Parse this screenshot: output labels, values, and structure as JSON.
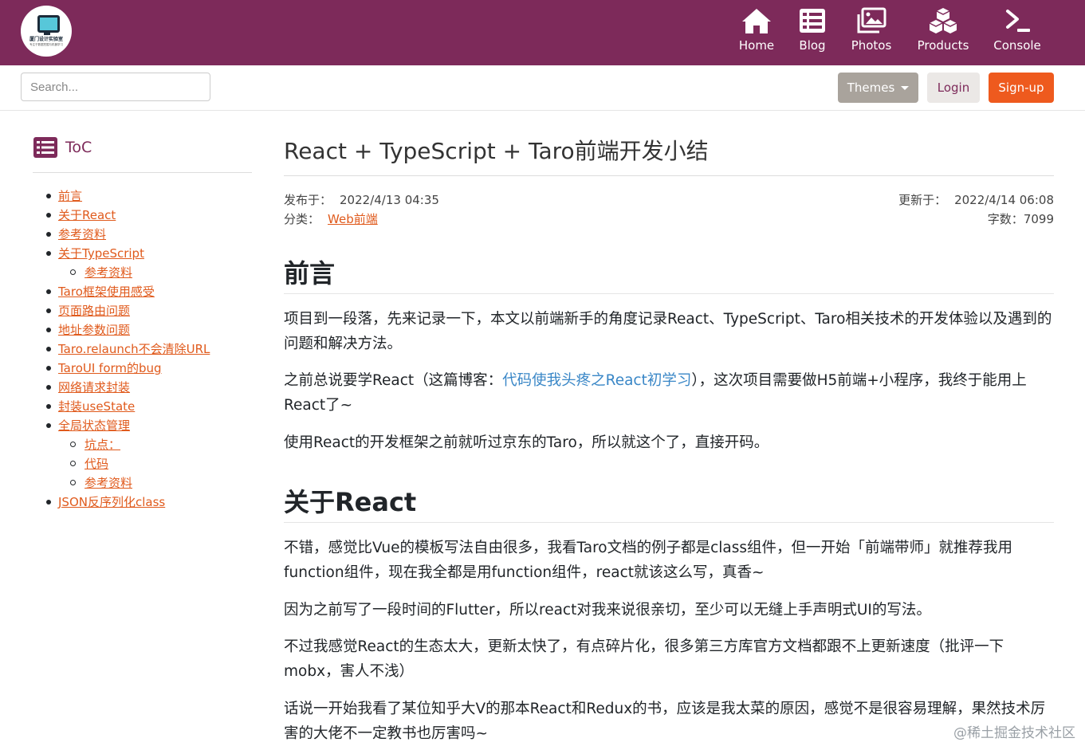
{
  "brand": {
    "logo_text": "厦门设计实验室",
    "logo_subtext": "专注于数据挖掘与机器学习"
  },
  "nav": {
    "items": [
      {
        "label": "Home",
        "icon": "home-icon"
      },
      {
        "label": "Blog",
        "icon": "list-icon"
      },
      {
        "label": "Photos",
        "icon": "photos-icon"
      },
      {
        "label": "Products",
        "icon": "cubes-icon"
      },
      {
        "label": "Console",
        "icon": "terminal-icon"
      }
    ]
  },
  "toolbar": {
    "search_placeholder": "Search...",
    "themes_label": "Themes",
    "login_label": "Login",
    "signup_label": "Sign-up"
  },
  "colors": {
    "brand": "#7d2a5a",
    "accent": "#ee5a1e",
    "link": "#e05a1c"
  },
  "toc": {
    "title": "ToC",
    "items": [
      {
        "label": "前言",
        "level": 1
      },
      {
        "label": "关于React",
        "level": 1
      },
      {
        "label": "参考资料",
        "level": 1
      },
      {
        "label": "关于TypeScript",
        "level": 1
      },
      {
        "label": "参考资料",
        "level": 2
      },
      {
        "label": "Taro框架使用感受",
        "level": 1
      },
      {
        "label": "页面路由问题",
        "level": 1
      },
      {
        "label": "地址参数问题",
        "level": 1
      },
      {
        "label": "Taro.relaunch不会清除URL",
        "level": 1
      },
      {
        "label": "TaroUI form的bug",
        "level": 1
      },
      {
        "label": "网络请求封装",
        "level": 1
      },
      {
        "label": "封装useState",
        "level": 1
      },
      {
        "label": "全局状态管理",
        "level": 1
      },
      {
        "label": "坑点：",
        "level": 2
      },
      {
        "label": "代码",
        "level": 2
      },
      {
        "label": "参考资料",
        "level": 2
      },
      {
        "label": "JSON反序列化class",
        "level": 1
      }
    ]
  },
  "article": {
    "title": "React + TypeScript + Taro前端开发小结",
    "published_label": "发布于：",
    "published_value": "2022/4/13 04:35",
    "category_label": "分类：",
    "category_value": "Web前端",
    "updated_label": "更新于：",
    "updated_value": "2022/4/14 06:08",
    "words_label": "字数：",
    "words_value": "7099",
    "sections": [
      {
        "heading": "前言",
        "paragraphs": [
          "项目到一段落，先来记录一下，本文以前端新手的角度记录React、TypeScript、Taro相关技术的开发体验以及遇到的问题和解决方法。",
          {
            "before": "之前总说要学React（这篇博客：",
            "link": "代码使我头疼之React初学习",
            "after": "），这次项目需要做H5前端+小程序，我终于能用上React了~"
          },
          "使用React的开发框架之前就听过京东的Taro，所以就这个了，直接开码。"
        ]
      },
      {
        "heading": "关于React",
        "paragraphs": [
          "不错，感觉比Vue的模板写法自由很多，我看Taro文档的例子都是class组件，但一开始「前端带师」就推荐我用function组件，现在我全都是用function组件，react就该这么写，真香~",
          "因为之前写了一段时间的Flutter，所以react对我来说很亲切，至少可以无缝上手声明式UI的写法。",
          "不过我感觉React的生态太大，更新太快了，有点碎片化，很多第三方库官方文档都跟不上更新速度（批评一下mobx，害人不浅）",
          "话说一开始我看了某位知乎大V的那本React和Redux的书，应该是我太菜的原因，感觉不是很容易理解，果然技术厉害的大佬不一定教书也厉害吗~"
        ]
      }
    ]
  },
  "watermark": "@稀土掘金技术社区"
}
